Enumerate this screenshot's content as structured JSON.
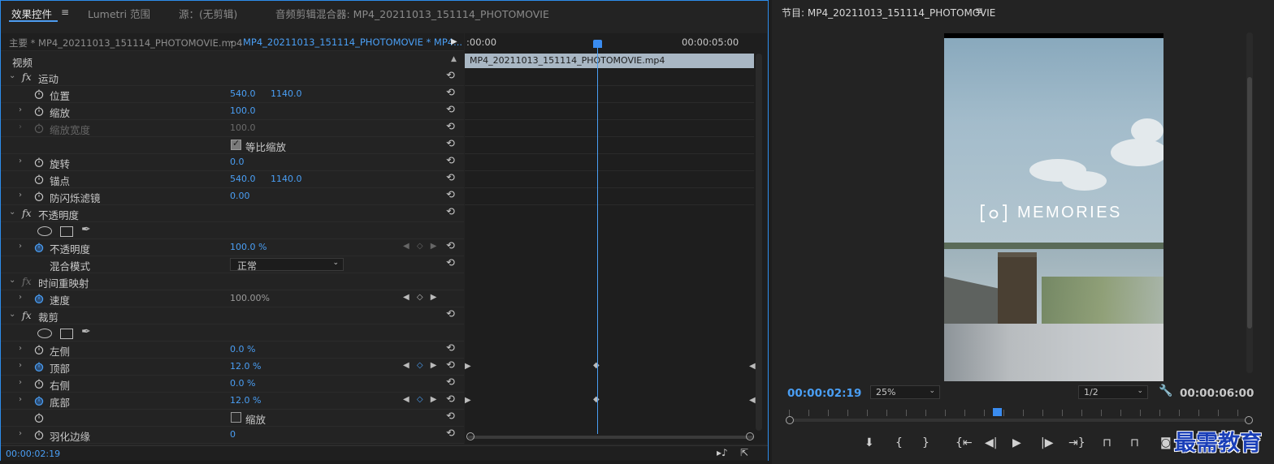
{
  "left_tabs": {
    "effect_controls": "效果控件",
    "lumetri": "Lumetri 范围",
    "source": "源：(无剪辑)",
    "audio_mixer": "音频剪辑混合器: MP4_20211013_151114_PHOTOMOVIE"
  },
  "menu_glyph": "≡",
  "ec": {
    "master_source": "主要 * MP4_20211013_151114_PHOTOMOVIE.mp4",
    "clip_source": "MP4_20211013_151114_PHOTOMOVIE * MP4...",
    "video_label": "视频",
    "groups": {
      "motion": "运动",
      "opacity": "不透明度",
      "time_remap": "时间重映射",
      "crop": "裁剪"
    },
    "fx": "fx",
    "params": {
      "position": {
        "name": "位置",
        "x": "540.0",
        "y": "1140.0"
      },
      "scale": {
        "name": "缩放",
        "value": "100.0"
      },
      "scale_width": {
        "name": "缩放宽度",
        "value": "100.0"
      },
      "uniform_scale": {
        "label": "等比缩放"
      },
      "rotation": {
        "name": "旋转",
        "value": "0.0"
      },
      "anchor": {
        "name": "锚点",
        "x": "540.0",
        "y": "1140.0"
      },
      "anti_flicker": {
        "name": "防闪烁滤镜",
        "value": "0.00"
      },
      "opacity": {
        "name": "不透明度",
        "value": "100.0 %"
      },
      "blend_mode": {
        "name": "混合模式",
        "value": "正常"
      },
      "speed": {
        "name": "速度",
        "value": "100.00%"
      },
      "left": {
        "name": "左侧",
        "value": "0.0 %"
      },
      "top": {
        "name": "顶部",
        "value": "12.0 %"
      },
      "right": {
        "name": "右侧",
        "value": "0.0 %"
      },
      "bottom": {
        "name": "底部",
        "value": "12.0 %"
      },
      "zoom": {
        "label": "缩放"
      },
      "feather": {
        "name": "羽化边缘",
        "value": "0"
      }
    },
    "timecode": "00:00:02:19",
    "timeline": {
      "t0": ":00:00",
      "t5": "00:00:05:00",
      "clip_name": "MP4_20211013_151114_PHOTOMOVIE.mp4"
    }
  },
  "program": {
    "title": "节目: MP4_20211013_151114_PHOTOMOVIE",
    "overlay_text": "MEMORIES",
    "current_time": "00:00:02:19",
    "zoom": "25%",
    "resolution": "1/2",
    "duration": "00:00:06:00"
  },
  "watermark": "最需教育",
  "colors": {
    "accent": "#4a9ff5",
    "panel_border": "#2d8ceb",
    "clip_bar": "#a9b7c4"
  }
}
